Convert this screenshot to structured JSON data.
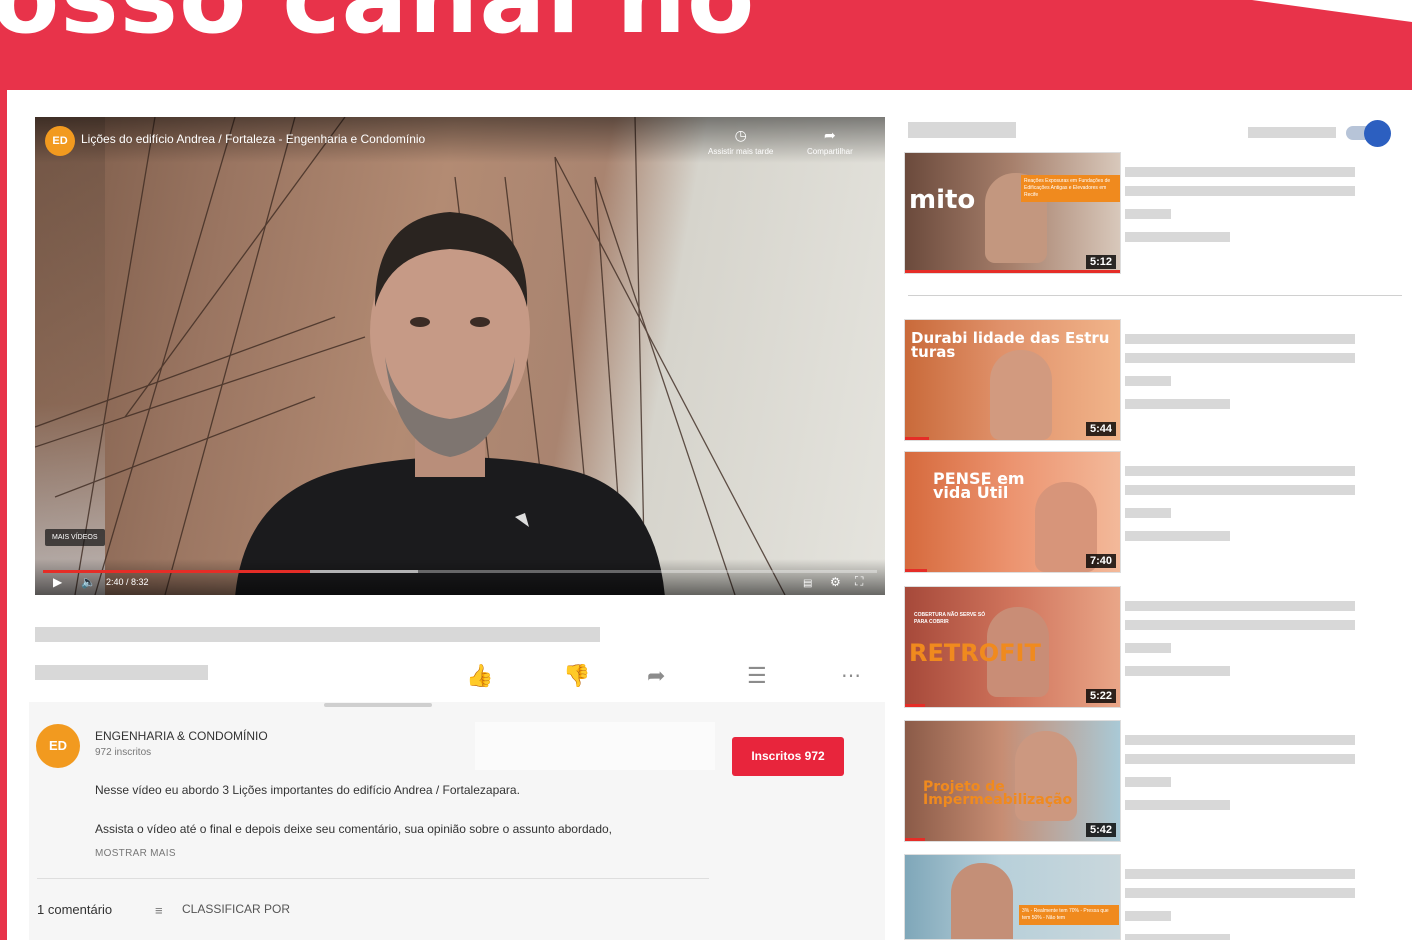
{
  "banner": {
    "text": "osso canal no"
  },
  "player": {
    "channel_logo_text": "ED",
    "title": "Lições do edifício Andrea / Fortaleza - Engenharia e Condomínio",
    "watch_later_label": "Assistir mais tarde",
    "share_label": "Compartilhar",
    "more_videos_label": "MAIS VÍDEOS",
    "time": "2:40 / 8:32",
    "progress_fraction": 0.32,
    "buffer_fraction": 0.45
  },
  "channel": {
    "avatar_text": "ED",
    "name": "ENGENHARIA & CONDOMÍNIO",
    "subscribers": "972 inscritos",
    "subscribe_label": "Inscritos 972"
  },
  "description": {
    "line1": "Nesse vídeo eu abordo 3 Lições importantes do edifício Andrea / Fortalezapara.",
    "line2": "Assista o vídeo até o final e depois deixe seu comentário, sua opinião sobre o assunto abordado,",
    "show_more": "MOSTRAR MAIS"
  },
  "comments": {
    "count_label": "1 comentário",
    "sort_label": "CLASSIFICAR POR"
  },
  "related": [
    {
      "big_text": "mito",
      "note": "Reações Exposuras em Fundações de Edificações Antigas e Elevadores em Recife",
      "duration": "5:12"
    },
    {
      "big_text": "Durabi lidade das Estru turas",
      "duration": "5:44"
    },
    {
      "big_text": "PENSE em vida Útil",
      "duration": "7:40"
    },
    {
      "big_text": "RETROFIT",
      "note": "COBERTURA NÃO SERVE SÓ PARA COBRIR",
      "duration": "5:22"
    },
    {
      "big_text": "Projeto de Impermeabilização",
      "duration": "5:42"
    },
    {
      "big_text": "",
      "note": "3% - Realmente tem 70% - Pressa que tem 50% - Não tem",
      "duration": ""
    }
  ],
  "colors": {
    "brand_red": "#e8334a",
    "subscribe_red": "#e8253c",
    "progress_red": "#e52d27",
    "logo_orange": "#f29a1f",
    "toggle_blue": "#2c5fc0"
  },
  "icons": [
    "clock-icon",
    "share-icon",
    "play-icon",
    "volume-icon",
    "captions-icon",
    "settings-icon",
    "fullscreen-icon",
    "like-icon",
    "dislike-icon",
    "share-arrow-icon",
    "add-to-playlist-icon",
    "more-icon",
    "sort-icon"
  ]
}
